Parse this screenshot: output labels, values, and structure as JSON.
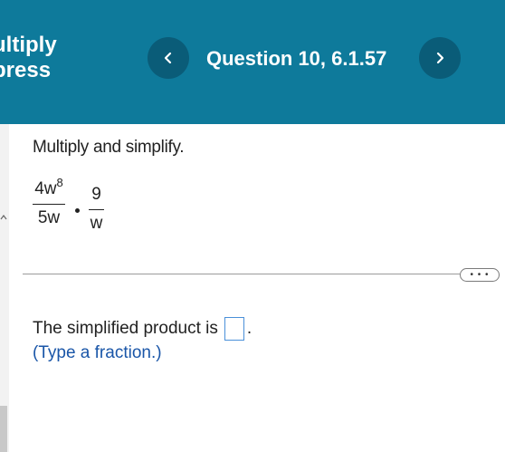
{
  "app": {
    "title_line1": "ultiply",
    "title_line2": "press"
  },
  "header": {
    "question_title": "Question 10, 6.1.57",
    "prev_icon": "chevron-left-icon",
    "next_icon": "chevron-right-icon"
  },
  "problem": {
    "instruction": "Multiply and simplify.",
    "fraction1": {
      "numerator": "4w",
      "numerator_exponent": "8",
      "denominator": "5w"
    },
    "operator": "·",
    "fraction2": {
      "numerator": "9",
      "denominator": "w"
    }
  },
  "more_button": {
    "label": "• • •"
  },
  "answer": {
    "prompt": "The simplified product is",
    "suffix": ".",
    "hint": "(Type a fraction.)"
  },
  "colors": {
    "header_bg": "#0e7a9b",
    "nav_button_bg": "#0a5c78",
    "hint_text": "#1a56a8",
    "answer_box_border": "#4a90d9"
  }
}
